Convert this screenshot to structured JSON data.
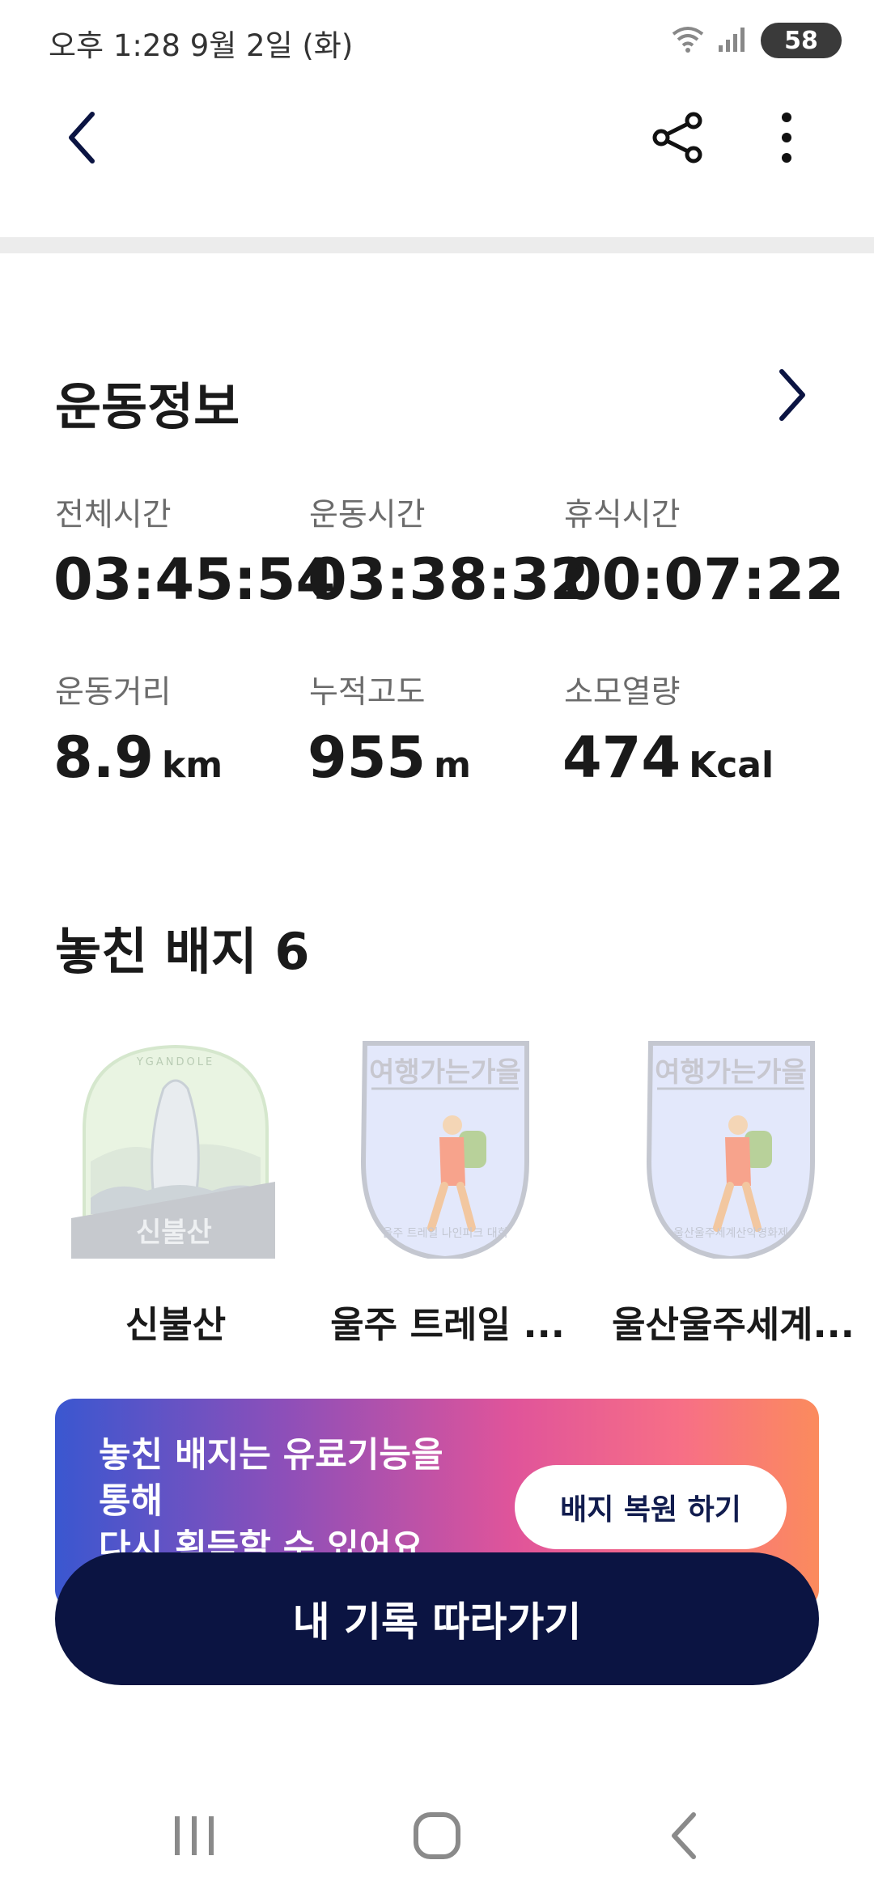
{
  "status_bar": {
    "time": "오후 1:28  9월 2일 (화)",
    "battery": "58",
    "icons": [
      "wifi-icon",
      "signal-icon",
      "battery-icon"
    ]
  },
  "app_bar": {
    "icons": [
      "back-arrow-icon",
      "share-icon",
      "more-vert-icon"
    ]
  },
  "exercise_info": {
    "title": "운동정보",
    "stats": [
      {
        "label": "전체시간",
        "value": "03:45:54",
        "unit": ""
      },
      {
        "label": "운동시간",
        "value": "03:38:32",
        "unit": ""
      },
      {
        "label": "휴식시간",
        "value": "00:07:22",
        "unit": ""
      },
      {
        "label": "운동거리",
        "value": "8.9",
        "unit": "km"
      },
      {
        "label": "누적고도",
        "value": "955",
        "unit": "m"
      },
      {
        "label": "소모열량",
        "value": "474",
        "unit": "Kcal"
      }
    ]
  },
  "missed_badges": {
    "title": "놓친 배지 6",
    "items": [
      {
        "name": "신불산",
        "badge_text": "신불산",
        "arc_text": "YGANDOLE"
      },
      {
        "name": "울주 트레일 ...",
        "badge_text": "여행가는가을",
        "arc_text": "울주 트레일 나인피크 대회"
      },
      {
        "name": "울산울주세계...",
        "badge_text": "여행가는가을",
        "arc_text": "울산울주세계산악영화제"
      }
    ]
  },
  "promo": {
    "text_line1": "놓친 배지는 유료기능을",
    "text_line2": "통해",
    "text_line3": "다시 획득할 수 있어요",
    "button_label": "배지 복원 하기"
  },
  "cta": {
    "label": "내 기록 따라가기"
  },
  "colors": {
    "navy": "#0b1442",
    "muted_text": "#6b6b6b",
    "divider": "#ececec"
  }
}
